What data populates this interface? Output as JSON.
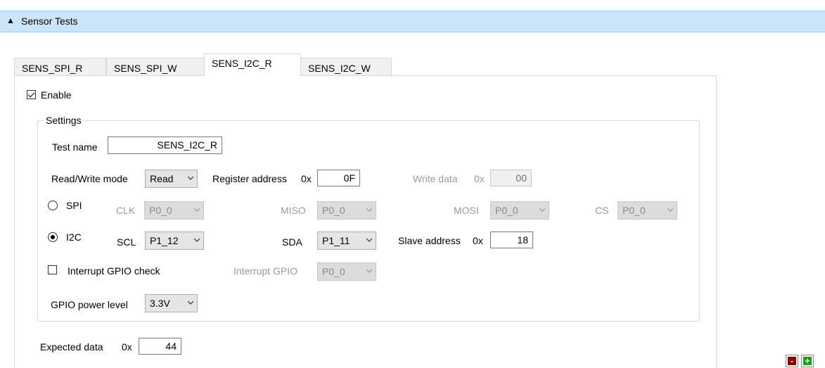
{
  "section": {
    "title": "Sensor Tests",
    "toggle_icon": "triangle-up-icon"
  },
  "tabs": [
    {
      "label": "SENS_SPI_R"
    },
    {
      "label": "SENS_SPI_W"
    },
    {
      "label": "SENS_I2C_R"
    },
    {
      "label": "SENS_I2C_W"
    }
  ],
  "active_tab": "SENS_I2C_R",
  "enable": {
    "label": "Enable",
    "checked": true
  },
  "settings": {
    "title": "Settings",
    "test_name_label": "Test name",
    "test_name_value": "SENS_I2C_R",
    "rw_mode_label": "Read/Write mode",
    "rw_mode_value": "Read",
    "register_address_label": "Register address",
    "register_prefix": "0x",
    "register_address_value": "0F",
    "write_data_label": "Write data",
    "write_data_prefix": "0x",
    "write_data_value": "00",
    "spi": {
      "label": "SPI",
      "selected": false,
      "clk_label": "CLK",
      "clk_value": "P0_0",
      "miso_label": "MISO",
      "miso_value": "P0_0",
      "mosi_label": "MOSI",
      "mosi_value": "P0_0",
      "cs_label": "CS",
      "cs_value": "P0_0"
    },
    "i2c": {
      "label": "I2C",
      "selected": true,
      "scl_label": "SCL",
      "scl_value": "P1_12",
      "sda_label": "SDA",
      "sda_value": "P1_11",
      "slave_address_label": "Slave address",
      "slave_prefix": "0x",
      "slave_address_value": "18"
    },
    "interrupt_check_label": "Interrupt GPIO check",
    "interrupt_check_checked": false,
    "interrupt_gpio_label": "Interrupt GPIO",
    "interrupt_gpio_value": "P0_0",
    "gpio_power_label": "GPIO power level",
    "gpio_power_value": "3.3V"
  },
  "expected_data": {
    "label": "Expected data",
    "prefix": "0x",
    "value": "44"
  },
  "buttons": {
    "remove_label": "-",
    "add_label": "+",
    "remove_color": "#8b0000",
    "add_color": "#1e9e1e"
  }
}
